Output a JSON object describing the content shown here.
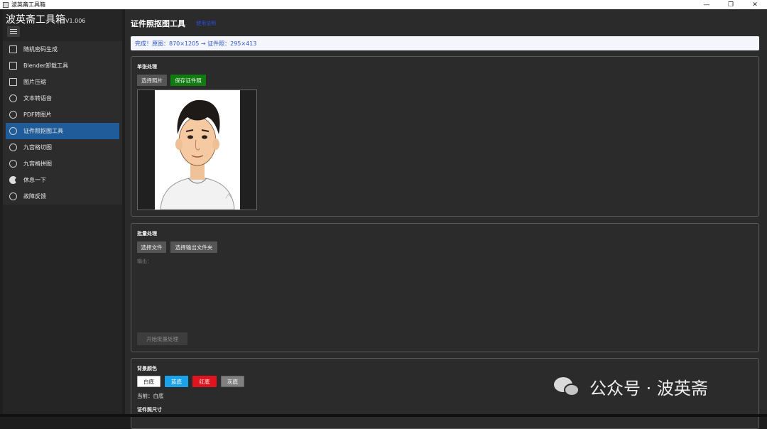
{
  "window": {
    "title": "波英斋工具箱",
    "controls": [
      "—",
      "❐",
      "✕"
    ]
  },
  "sidebar": {
    "app_name": "波英斋工具箱",
    "version": "V1.006",
    "items": [
      {
        "label": "随机密码生成",
        "icon": "keyboard-icon"
      },
      {
        "label": "Blender卸载工具",
        "icon": "grid-icon"
      },
      {
        "label": "图片压缩",
        "icon": "image-icon"
      },
      {
        "label": "文本转语音",
        "icon": "fingerprint-icon"
      },
      {
        "label": "PDF转图片",
        "icon": "fingerprint-icon"
      },
      {
        "label": "证件照抠图工具",
        "icon": "fingerprint-icon",
        "active": true
      },
      {
        "label": "九宫格切图",
        "icon": "fingerprint-icon"
      },
      {
        "label": "九宫格拼图",
        "icon": "fingerprint-icon"
      },
      {
        "label": "休息一下",
        "icon": "flag-icon"
      },
      {
        "label": "故障反馈",
        "icon": "phone-icon"
      }
    ]
  },
  "main": {
    "title": "证件照抠图工具",
    "title_link": "使用说明",
    "status": "完成！原图：870×1205 → 证件照：295×413",
    "single": {
      "title": "单张处理",
      "select_button": "选择照片",
      "save_button": "保存证件照"
    },
    "batch": {
      "title": "批量处理",
      "select_files": "选择文件",
      "select_output": "选择输出文件夹",
      "output_label": "输出：",
      "start_button": "开始批量处理"
    },
    "background": {
      "title": "背景颜色",
      "options": [
        {
          "label": "白底",
          "bg": "#ffffff",
          "fg": "#222222"
        },
        {
          "label": "蓝底",
          "bg": "#1aa3e8",
          "fg": "#ffffff"
        },
        {
          "label": "红底",
          "bg": "#e0141e",
          "fg": "#ffffff"
        },
        {
          "label": "灰底",
          "bg": "#808080",
          "fg": "#ffffff"
        }
      ],
      "current": "当前：白底"
    },
    "size_title": "证件照尺寸"
  },
  "watermark": "公众号 · 波英斋"
}
